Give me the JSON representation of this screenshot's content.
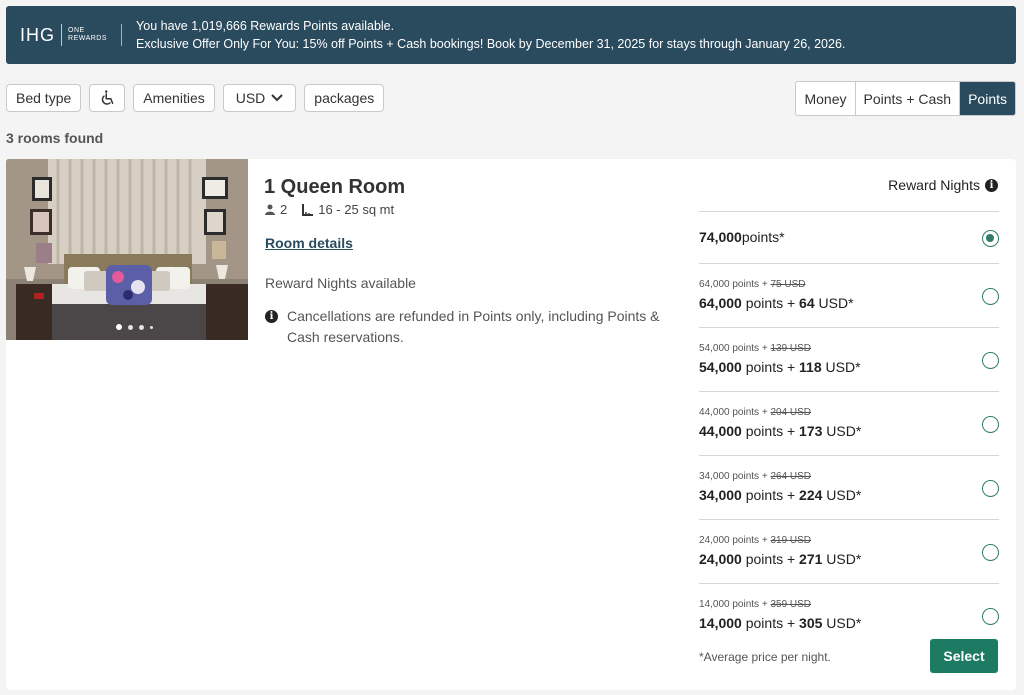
{
  "banner": {
    "logo_main": "IHG",
    "logo_sub_1": "ONE",
    "logo_sub_2": "REWARDS",
    "line1": "You have 1,019,666 Rewards Points available.",
    "line2": "Exclusive Offer Only For You: 15% off Points + Cash bookings! Book by December 31, 2025 for stays through January 26, 2026."
  },
  "filters": {
    "bed_type": "Bed type",
    "accessibility_icon": "wheelchair-icon",
    "amenities": "Amenities",
    "currency": "USD",
    "packages": "packages"
  },
  "payment_toggle": {
    "options": [
      "Money",
      "Points + Cash",
      "Points"
    ],
    "selected": "Points"
  },
  "results_count": "3 rooms found",
  "room": {
    "title": "1 Queen Room",
    "guests": "2",
    "size": "16 - 25 sq mt",
    "details_link": "Room details",
    "availability": "Reward Nights available",
    "cancellation": "Cancellations are refunded in Points only, including Points & Cash reservations.",
    "photo_count": 4,
    "photo_index": 1
  },
  "rates": {
    "header": "Reward Nights",
    "options": [
      {
        "old_points": "",
        "old_cash": "",
        "points": "74,000",
        "cash": "",
        "selected": true
      },
      {
        "old_points": "64,000 points +",
        "old_cash": "75 USD",
        "points": "64,000",
        "cash": "64",
        "selected": false
      },
      {
        "old_points": "54,000 points +",
        "old_cash": "139 USD",
        "points": "54,000",
        "cash": "118",
        "selected": false
      },
      {
        "old_points": "44,000 points +",
        "old_cash": "204 USD",
        "points": "44,000",
        "cash": "173",
        "selected": false
      },
      {
        "old_points": "34,000 points +",
        "old_cash": "264 USD",
        "points": "34,000",
        "cash": "224",
        "selected": false
      },
      {
        "old_points": "24,000 points +",
        "old_cash": "319 USD",
        "points": "24,000",
        "cash": "271",
        "selected": false
      },
      {
        "old_points": "14,000 points +",
        "old_cash": "359 USD",
        "points": "14,000",
        "cash": "305",
        "selected": false
      }
    ],
    "points_word": "points",
    "points_star": "points*",
    "plus": "+",
    "usd_star": "USD*",
    "footnote": "*Average price per night.",
    "select_label": "Select"
  },
  "colors": {
    "banner_bg": "#2a4a5e",
    "accent_green": "#1d7a63",
    "toggle_active": "#2a4a5e"
  }
}
